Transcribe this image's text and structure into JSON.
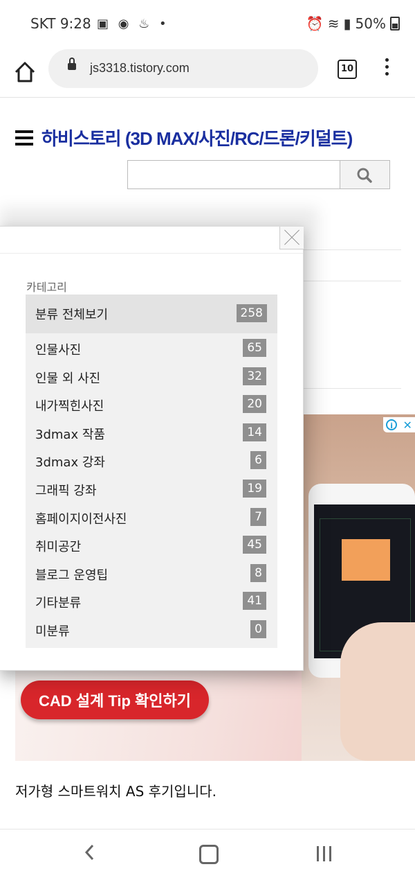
{
  "status_bar": {
    "carrier_time": "SKT 9:28",
    "battery": "50%"
  },
  "browser": {
    "url": "js3318.tistory.com",
    "tab_count": "10"
  },
  "blog": {
    "title": "하비스토리 (3D MAX/사진/RC/드론/키덜트)"
  },
  "ad": {
    "cta": "CAD 설계 Tip 확인하기"
  },
  "post": {
    "title": "저가형 스마트워치 AS 후기입니다."
  },
  "category_popup": {
    "heading": "카테고리",
    "items": [
      {
        "name": "분류 전체보기",
        "count": "258"
      },
      {
        "name": "인물사진",
        "count": "65"
      },
      {
        "name": "인물 외 사진",
        "count": "32"
      },
      {
        "name": "내가찍힌사진",
        "count": "20"
      },
      {
        "name": "3dmax 작품",
        "count": "14"
      },
      {
        "name": "3dmax 강좌",
        "count": "6"
      },
      {
        "name": "그래픽 강좌",
        "count": "19"
      },
      {
        "name": "홈페이지이전사진",
        "count": "7"
      },
      {
        "name": "취미공간",
        "count": "45"
      },
      {
        "name": "블로그 운영팁",
        "count": "8"
      },
      {
        "name": "기타분류",
        "count": "41"
      },
      {
        "name": "미분류",
        "count": "0"
      }
    ]
  }
}
